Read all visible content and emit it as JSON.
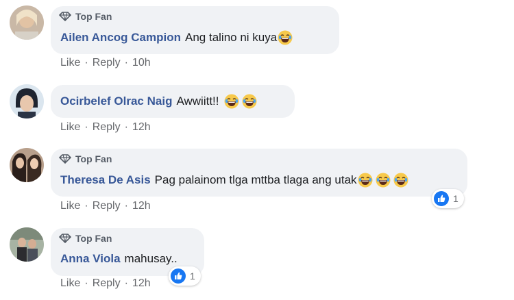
{
  "comments": [
    {
      "badge": "Top Fan",
      "author": "Ailen Ancog Campion",
      "text": "Ang talino ni kuya",
      "emoji_count": 1,
      "emoji": "laughing-tears-emoji",
      "like": "Like",
      "reply": "Reply",
      "time": "10h"
    },
    {
      "author": "Ocirbelef Olrac Naig",
      "text": "Awwiitt!!",
      "emoji_count": 2,
      "emoji": "laughing-tears-emoji",
      "like": "Like",
      "reply": "Reply",
      "time": "12h"
    },
    {
      "badge": "Top Fan",
      "author": "Theresa De Asis",
      "text": "Pag palainom tlga mttba tlaga ang utak",
      "emoji_count": 3,
      "emoji": "laughing-tears-emoji",
      "like": "Like",
      "reply": "Reply",
      "time": "12h",
      "reaction_count": "1",
      "reaction_icon": "like-reaction-icon"
    },
    {
      "badge": "Top Fan",
      "author": "Anna Viola",
      "text": "mahusay..",
      "emoji_count": 0,
      "like": "Like",
      "reply": "Reply",
      "time": "12h",
      "reaction_count": "1",
      "reaction_icon": "like-reaction-icon"
    }
  ],
  "colors": {
    "author": "#385898",
    "bubble": "#f0f2f5",
    "meta": "#65676b",
    "like_blue": "#1877f2"
  }
}
